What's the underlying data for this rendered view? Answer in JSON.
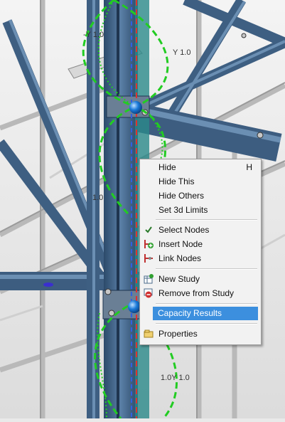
{
  "scene": {
    "labels": [
      "-Y 1.0",
      "Y 1.0",
      "1.0",
      "1.0Y 1.0"
    ]
  },
  "context_menu": {
    "items": [
      {
        "label": "Hide",
        "shortcut": "H",
        "icon": null
      },
      {
        "label": "Hide This",
        "icon": null
      },
      {
        "label": "Hide Others",
        "icon": null
      },
      {
        "label": "Set 3d Limits",
        "icon": null
      },
      {
        "label": "Select Nodes",
        "icon": "check-icon"
      },
      {
        "label": "Insert Node",
        "icon": "insert-node-icon"
      },
      {
        "label": "Link Nodes",
        "icon": "link-nodes-icon"
      },
      {
        "label": "New Study",
        "icon": "new-study-icon"
      },
      {
        "label": "Remove from Study",
        "icon": "remove-icon"
      },
      {
        "label": "Capacity Results",
        "icon": null,
        "highlighted": true
      },
      {
        "label": "Properties",
        "icon": "properties-icon"
      }
    ]
  },
  "colors": {
    "highlight": "#3c8fde",
    "steel": "#4f6f91",
    "mode_shape": "#22cc22",
    "reference_line_red": "#e03030",
    "reference_line_blue": "#3060e0"
  }
}
